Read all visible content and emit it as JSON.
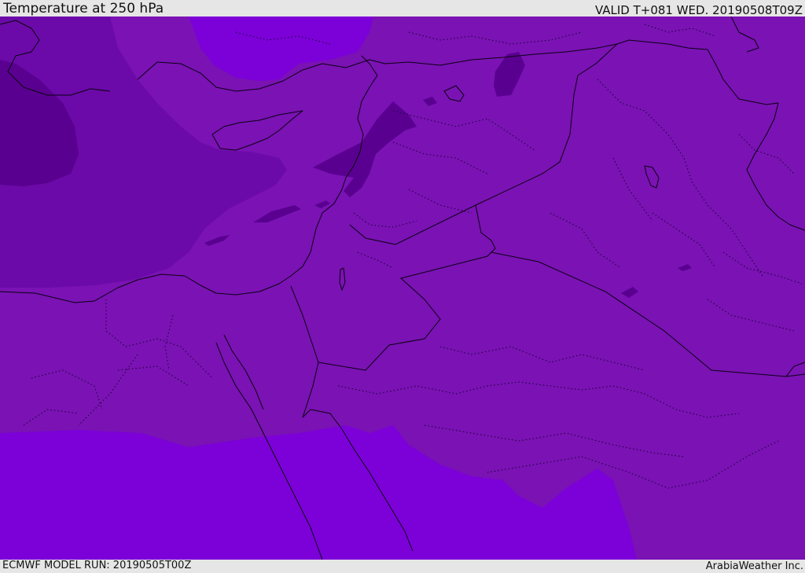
{
  "header": {
    "title": "Temperature at 250 hPa",
    "valid": "VALID T+081 WED. 20190508T09Z"
  },
  "footer": {
    "model_run": "ECMWF MODEL RUN: 20190505T00Z",
    "credit": "ArabiaWeather Inc."
  },
  "map": {
    "colors": {
      "background": "#7a12b4",
      "warm": "#7c00d8",
      "cold": "#6b0aa8",
      "coldest": "#5a0090",
      "line": "#0a0010"
    }
  }
}
